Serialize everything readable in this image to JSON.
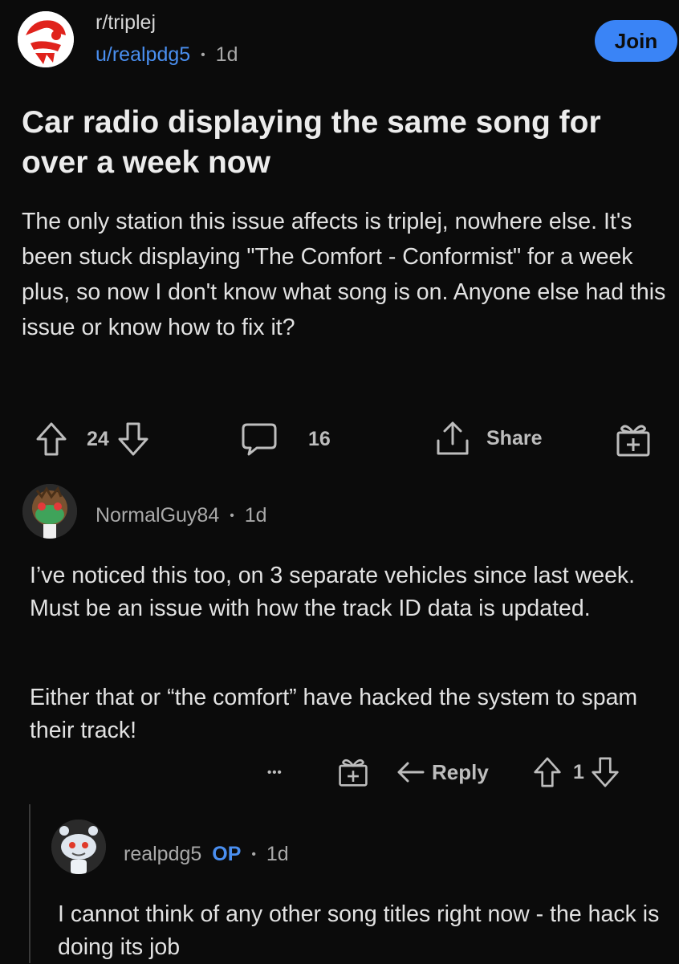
{
  "post": {
    "subreddit": "r/triplej",
    "author": "u/realpdg5",
    "separator": "•",
    "age": "1d",
    "join_label": "Join",
    "title": "Car radio displaying the same song for over a week now",
    "body": "The only station this issue affects is triplej, nowhere else. It's been stuck displaying \"The Comfort - Conformist\" for a week plus, so now I don't know what song is on. Anyone else had this issue or know how to fix it?",
    "votes": "24",
    "comments": "16",
    "share_label": "Share"
  },
  "comments": [
    {
      "author": "NormalGuy84",
      "separator": "•",
      "age": "1d",
      "paragraphs": [
        "I’ve noticed this too, on 3 separate vehicles since last week. Must be an issue with how the track ID data is updated.",
        "Either that or “the comfort” have hacked the system to spam their track!"
      ],
      "more_label": "•••",
      "reply_label": "Reply",
      "votes": "1"
    },
    {
      "author": "realpdg5",
      "op_badge": "OP",
      "separator": "•",
      "age": "1d",
      "text": "I cannot think of any other song titles right now - the hack is doing its job"
    }
  ],
  "colors": {
    "background": "#0b0b0b",
    "accent_blue": "#3a84f6",
    "link_blue": "#4a8ff0",
    "muted_text": "#a9a9a9",
    "icon_gray": "#bdbdbd"
  },
  "icons": [
    "triplej-logo-icon",
    "upvote-icon",
    "downvote-icon",
    "comment-icon",
    "share-icon",
    "award-icon",
    "more-icon",
    "reply-icon",
    "snoo-avatar-icon",
    "custom-avatar-icon"
  ]
}
